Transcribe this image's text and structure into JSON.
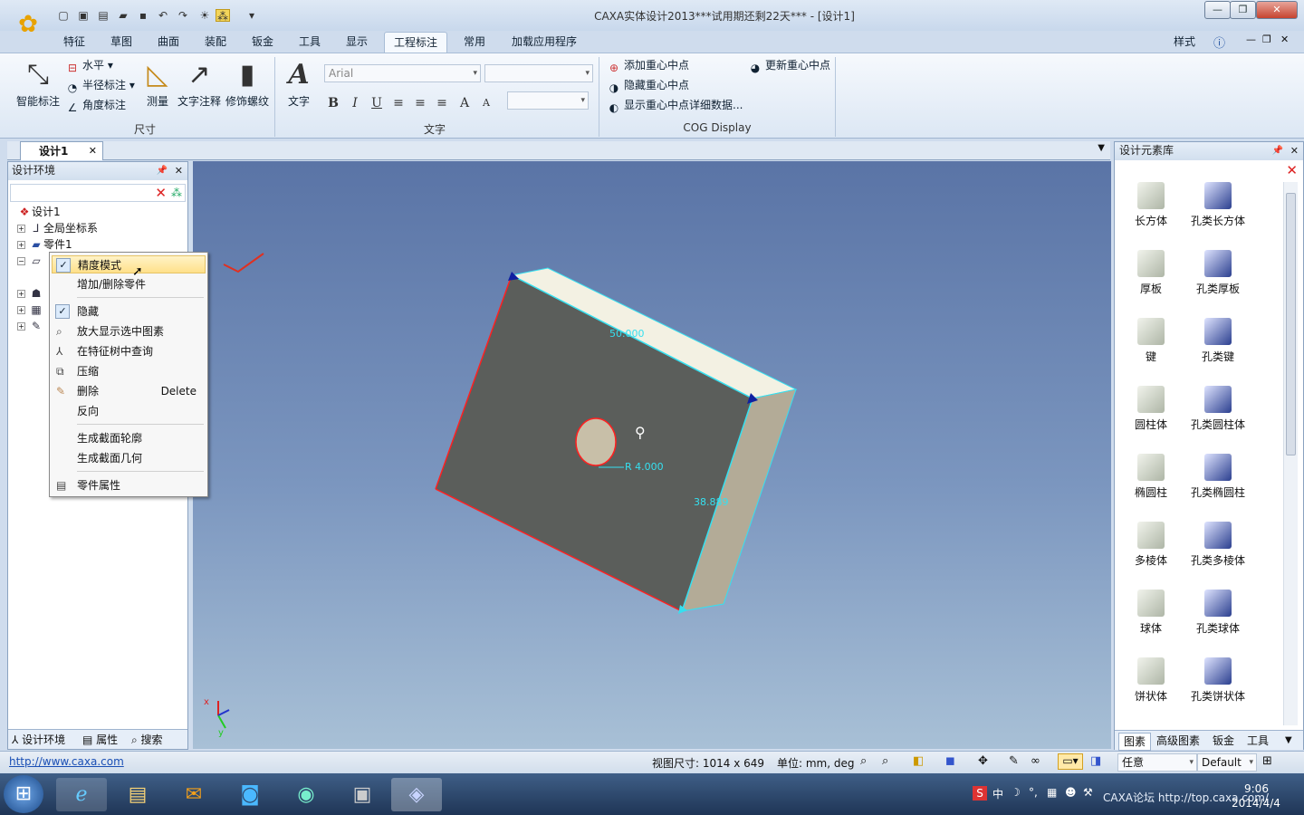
{
  "window": {
    "title": "CAXA实体设计2013***试用期还剩22天*** - [设计1]",
    "minimize": "—",
    "maximize": "❐",
    "close": "✕"
  },
  "ribbon": {
    "tabs": [
      "特征",
      "草图",
      "曲面",
      "装配",
      "钣金",
      "工具",
      "显示",
      "工程标注",
      "常用",
      "加载应用程序"
    ],
    "active_tab": "工程标注",
    "right_label": "样式",
    "dimension_group": {
      "label": "尺寸",
      "smart": "智能标注",
      "horizontal": "水平",
      "radius": "半径标注",
      "angle": "角度标注",
      "measure": "测量",
      "text_annot": "文字注释",
      "thread": "修饰螺纹"
    },
    "text_group": {
      "label": "文字",
      "text_button": "文字",
      "font": "Arial",
      "bold": "B",
      "italic": "I",
      "underline": "U"
    },
    "cog_group": {
      "label": "COG Display",
      "add": "添加重心中点",
      "update": "更新重心中点",
      "hide": "隐藏重心中点",
      "show_detail": "显示重心中点详细数据..."
    }
  },
  "doc_tab": "设计1",
  "left_panel": {
    "title": "设计环境",
    "tree": [
      {
        "label": "设计1"
      },
      {
        "label": "全局坐标系"
      },
      {
        "label": "零件1"
      }
    ],
    "bottom_tabs": [
      "设计环境",
      "属性",
      "搜索"
    ]
  },
  "context_menu": {
    "items": [
      {
        "label": "精度模式",
        "checked": true,
        "highlight": true
      },
      {
        "label": "增加/删除零件"
      },
      {
        "label": "隐藏",
        "checked": true
      },
      {
        "label": "放大显示选中图素"
      },
      {
        "label": "在特征树中查询"
      },
      {
        "label": "压缩"
      },
      {
        "label": "删除",
        "shortcut": "Delete"
      },
      {
        "label": "反向"
      },
      {
        "label": "生成截面轮廓"
      },
      {
        "label": "生成截面几何"
      },
      {
        "label": "零件属性"
      }
    ]
  },
  "viewport": {
    "dim_top": "50.000",
    "dim_right": "38.889",
    "dim_radius": "R 4.000",
    "axis_x": "x",
    "axis_y": "y"
  },
  "right_panel": {
    "title": "设计元素库",
    "items": [
      {
        "label": "长方体",
        "icon": "box-icon"
      },
      {
        "label": "孔类长方体",
        "icon": "hole-box-icon"
      },
      {
        "label": "厚板",
        "icon": "plate-icon"
      },
      {
        "label": "孔类厚板",
        "icon": "hole-plate-icon"
      },
      {
        "label": "键",
        "icon": "key-icon"
      },
      {
        "label": "孔类键",
        "icon": "hole-key-icon"
      },
      {
        "label": "圆柱体",
        "icon": "cylinder-icon"
      },
      {
        "label": "孔类圆柱体",
        "icon": "hole-cylinder-icon"
      },
      {
        "label": "椭圆柱",
        "icon": "ellipse-cylinder-icon"
      },
      {
        "label": "孔类椭圆柱",
        "icon": "hole-ellipse-cylinder-icon"
      },
      {
        "label": "多棱体",
        "icon": "prism-icon"
      },
      {
        "label": "孔类多棱体",
        "icon": "hole-prism-icon"
      },
      {
        "label": "球体",
        "icon": "sphere-icon"
      },
      {
        "label": "孔类球体",
        "icon": "hole-sphere-icon"
      },
      {
        "label": "饼状体",
        "icon": "pie-icon"
      },
      {
        "label": "孔类饼状体",
        "icon": "hole-pie-icon"
      }
    ],
    "bottom_tabs": [
      "图素",
      "高级图素",
      "钣金",
      "工具"
    ]
  },
  "status_bar": {
    "link": "http://www.caxa.com",
    "view_size": "视图尺寸: 1014 x 649",
    "units": "单位: mm, deg",
    "filter": "任意",
    "style": "Default"
  },
  "taskbar": {
    "ime": "中",
    "time": "9:06",
    "date": "2014/4/4",
    "watermark": "CAXA论坛 http://top.caxa.com/"
  },
  "colors": {
    "ribbon_bg": "#dce7f4",
    "viewport_top": "#5a74a6",
    "viewport_bottom": "#a8c0d6",
    "part_face": "#5b5e5b",
    "part_top": "#f3f1e3",
    "part_side": "#b3ab97",
    "highlight_edge": "#ff2020",
    "dimension_color": "#35e0f0"
  }
}
